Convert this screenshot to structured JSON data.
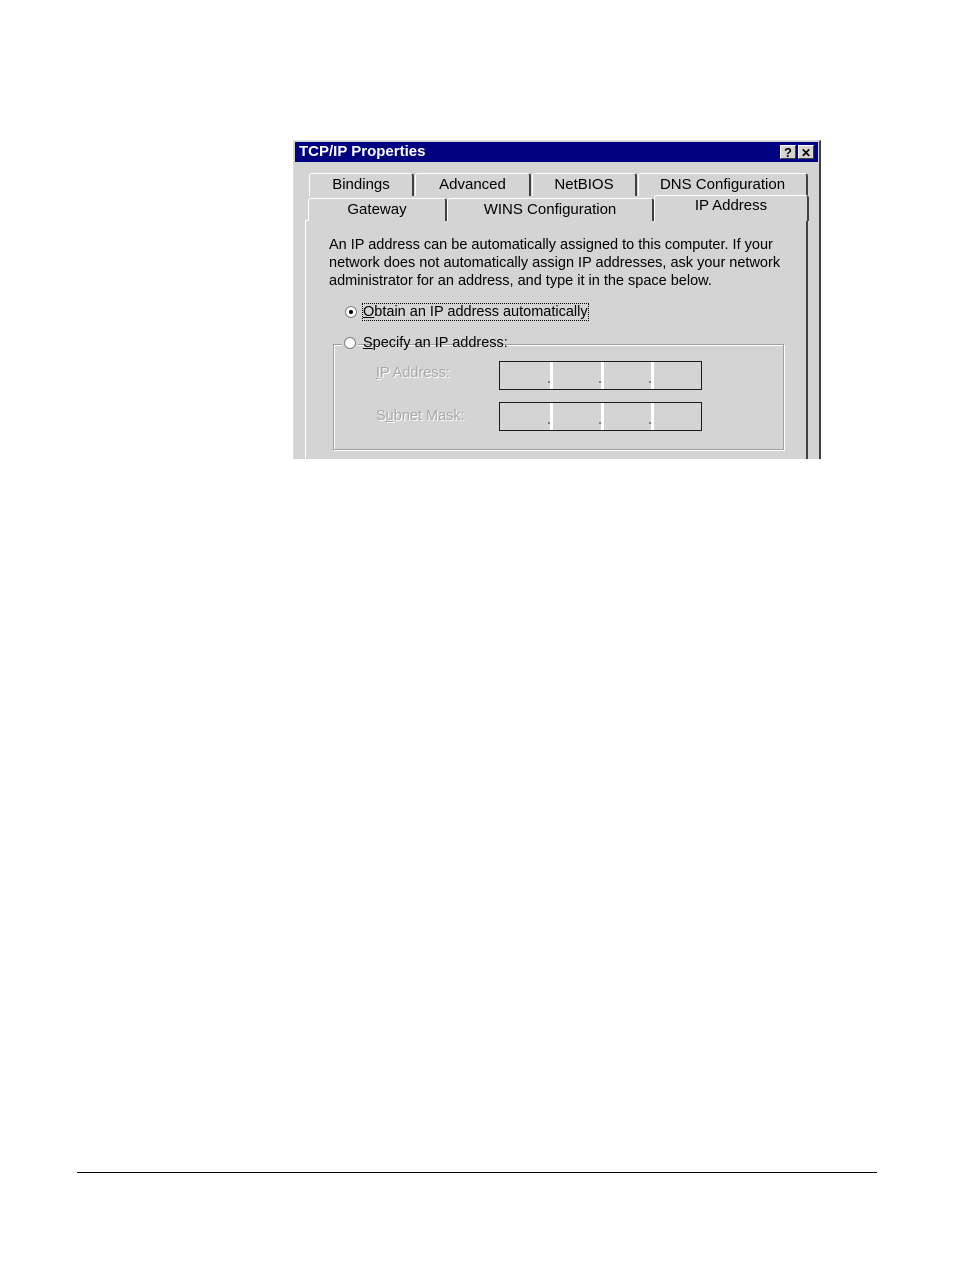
{
  "dialog": {
    "title": "TCP/IP Properties",
    "help_button": "?",
    "close_button": "✕",
    "tabs_row1": [
      {
        "label": "Bindings"
      },
      {
        "label": "Advanced"
      },
      {
        "label": "NetBIOS"
      },
      {
        "label": "DNS Configuration"
      }
    ],
    "tabs_row2": [
      {
        "label": "Gateway"
      },
      {
        "label": "WINS Configuration"
      },
      {
        "label": "IP Address",
        "active": true
      }
    ],
    "description": "An IP address can be automatically assigned to this computer.  If your network does not automatically assign IP addresses, ask your network administrator for an address, and type it in the space below.",
    "options": {
      "obtain_auto": {
        "label_rest": "btain an IP address automatically",
        "mnemonic": "O",
        "selected": true
      },
      "specify": {
        "label_rest": "pecify an IP address:",
        "mnemonic": "S",
        "selected": false
      }
    },
    "fields": {
      "ip_address": {
        "label_pre": "",
        "mnemonic": "I",
        "label_rest": "P Address:",
        "value": [
          "",
          "",
          "",
          ""
        ],
        "enabled": false
      },
      "subnet_mask": {
        "label_pre": "S",
        "mnemonic": "u",
        "label_rest": "bnet Mask:",
        "value": [
          "",
          "",
          "",
          ""
        ],
        "enabled": false
      }
    }
  }
}
